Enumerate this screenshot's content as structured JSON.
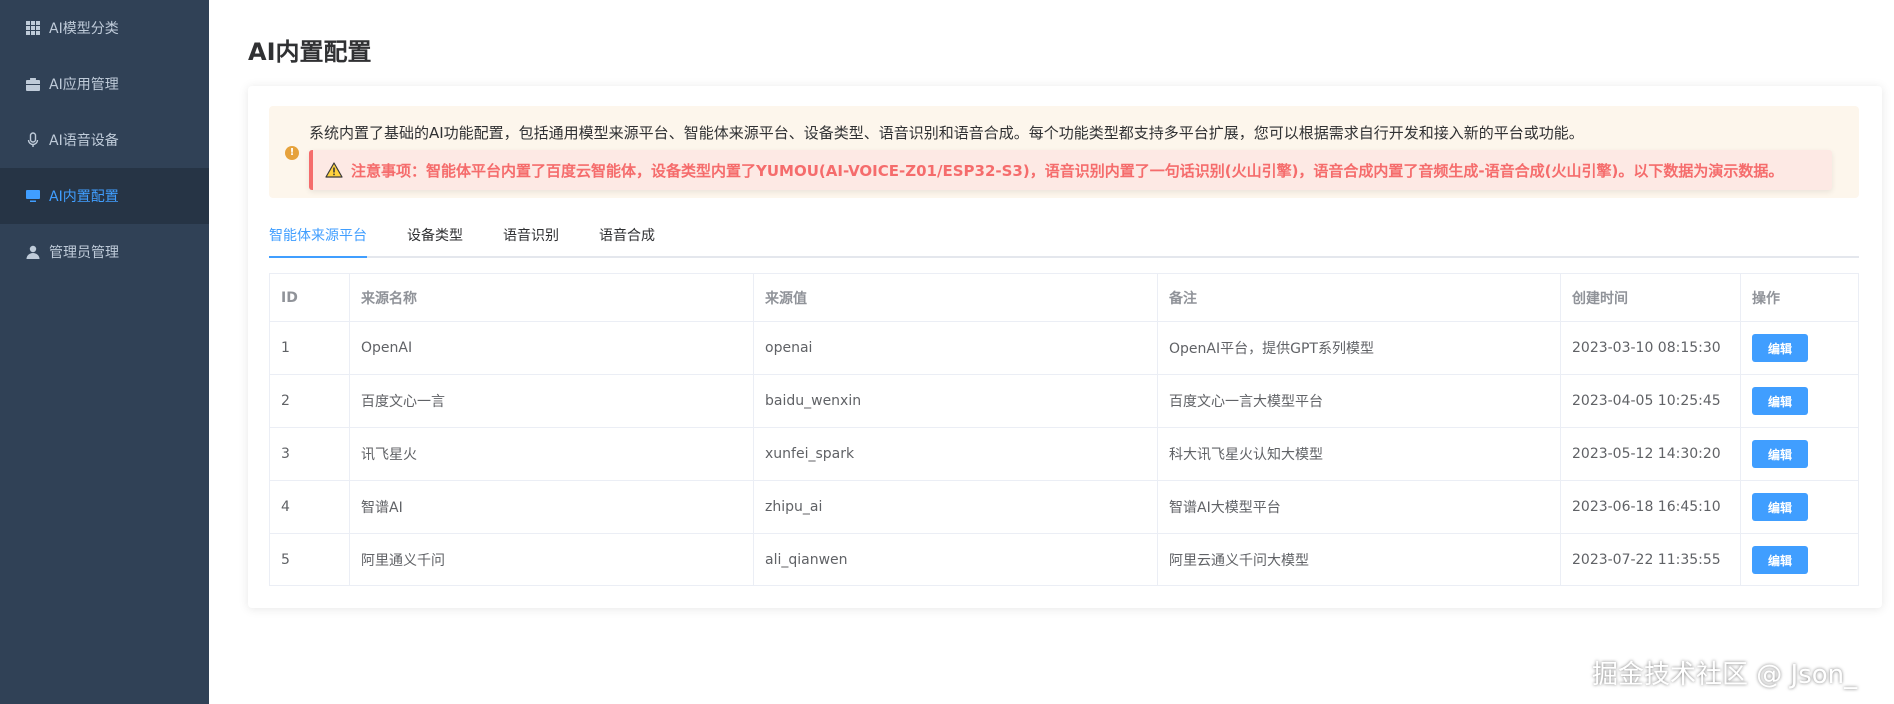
{
  "sidebar": {
    "items": [
      {
        "label": "AI模型分类",
        "icon": "grid-icon"
      },
      {
        "label": "AI应用管理",
        "icon": "briefcase-icon"
      },
      {
        "label": "AI语音设备",
        "icon": "microphone-icon"
      },
      {
        "label": "AI内置配置",
        "icon": "monitor-icon",
        "active": true
      },
      {
        "label": "管理员管理",
        "icon": "user-icon"
      }
    ]
  },
  "page": {
    "title": "AI内置配置"
  },
  "notice": {
    "description": "系统内置了基础的AI功能配置，包括通用模型来源平台、智能体来源平台、设备类型、语音识别和语音合成。每个功能类型都支持多平台扩展，您可以根据需求自行开发和接入新的平台或功能。",
    "alert": "注意事项：智能体平台内置了百度云智能体，设备类型内置了YUMOU(AI-VOICE-Z01/ESP32-S3)，语音识别内置了一句话识别(火山引擎)，语音合成内置了音频生成-语音合成(火山引擎)。以下数据为演示数据。"
  },
  "tabs": [
    {
      "label": "智能体来源平台",
      "active": true
    },
    {
      "label": "设备类型"
    },
    {
      "label": "语音识别"
    },
    {
      "label": "语音合成"
    }
  ],
  "table": {
    "columns": [
      "ID",
      "来源名称",
      "来源值",
      "备注",
      "创建时间",
      "操作"
    ],
    "rows": [
      {
        "id": "1",
        "name": "OpenAI",
        "value": "openai",
        "remark": "OpenAI平台，提供GPT系列模型",
        "created": "2023-03-10 08:15:30",
        "action": "编辑"
      },
      {
        "id": "2",
        "name": "百度文心一言",
        "value": "baidu_wenxin",
        "remark": "百度文心一言大模型平台",
        "created": "2023-04-05 10:25:45",
        "action": "编辑"
      },
      {
        "id": "3",
        "name": "讯飞星火",
        "value": "xunfei_spark",
        "remark": "科大讯飞星火认知大模型",
        "created": "2023-05-12 14:30:20",
        "action": "编辑"
      },
      {
        "id": "4",
        "name": "智谱AI",
        "value": "zhipu_ai",
        "remark": "智谱AI大模型平台",
        "created": "2023-06-18 16:45:10",
        "action": "编辑"
      },
      {
        "id": "5",
        "name": "阿里通义千问",
        "value": "ali_qianwen",
        "remark": "阿里云通义千问大模型",
        "created": "2023-07-22 11:35:55",
        "action": "编辑"
      }
    ]
  },
  "watermark": "掘金技术社区 @ Json_",
  "colors": {
    "sidebar_bg": "#304156",
    "sidebar_active_bg": "#263445",
    "accent": "#409eff",
    "danger": "#f56c6c",
    "warning": "#e6a23c"
  }
}
